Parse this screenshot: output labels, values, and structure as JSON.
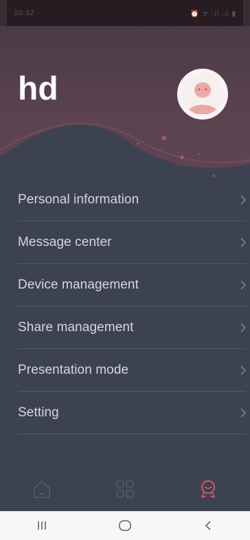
{
  "status_bar": {
    "time": "10:32",
    "left_icons": "✉ ▣ ⚙ ·",
    "right_icons": "⏰ ᯤ .ıl .ıl ▮"
  },
  "profile": {
    "username": "hd",
    "avatar_icon": "avatar-icon"
  },
  "menu": {
    "items": [
      {
        "label": "Personal information"
      },
      {
        "label": "Message center"
      },
      {
        "label": "Device management"
      },
      {
        "label": "Share management"
      },
      {
        "label": "Presentation mode"
      },
      {
        "label": "Setting"
      }
    ]
  },
  "tabbar": {
    "tabs": [
      {
        "icon": "home-icon",
        "active": false
      },
      {
        "icon": "apps-grid-icon",
        "active": false
      },
      {
        "icon": "profile-badge-icon",
        "active": true
      }
    ]
  },
  "system_nav": {
    "buttons": [
      "recent-apps-icon",
      "home-circle-icon",
      "back-icon"
    ]
  },
  "colors": {
    "accent": "#e0576a",
    "background": "#3d4252",
    "header": "#5b4350",
    "menu_text": "#d4d7de"
  }
}
